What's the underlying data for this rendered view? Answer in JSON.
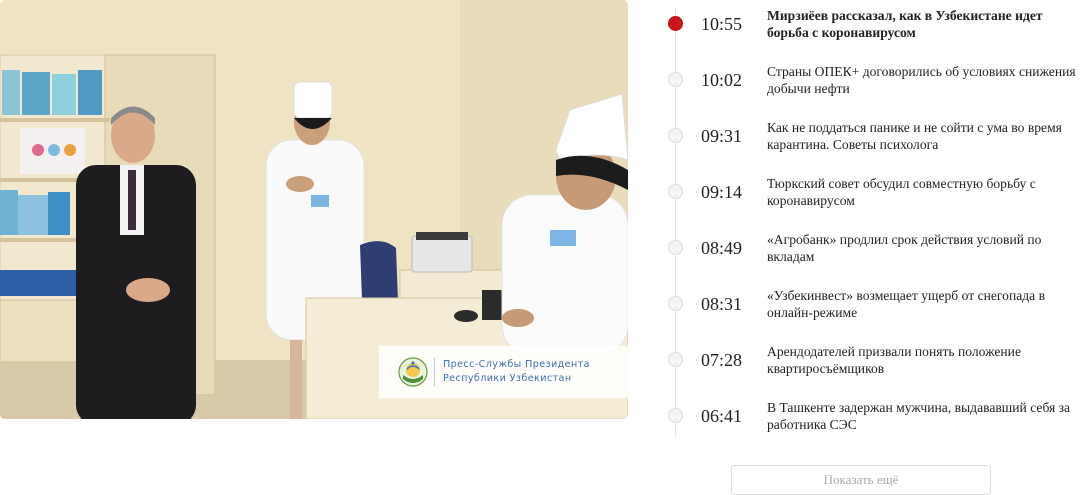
{
  "photo": {
    "credit_line1": "Пресс-Службы Президента",
    "credit_line2": "Республики Узбекистан",
    "emblem_icon": "uzbekistan-emblem-icon"
  },
  "news": [
    {
      "time": "10:55",
      "title": "Мирзиёев рассказал, как в Узбекистане идет борьба с коронавирусом",
      "active": true
    },
    {
      "time": "10:02",
      "title": "Страны ОПЕК+ договорились об условиях снижения добычи нефти",
      "active": false
    },
    {
      "time": "09:31",
      "title": "Как не поддаться панике и не сойти с ума во время карантина. Советы психолога",
      "active": false
    },
    {
      "time": "09:14",
      "title": "Тюркский совет обсудил совместную борьбу с коронавирусом",
      "active": false
    },
    {
      "time": "08:49",
      "title": "«Агробанк» продлил срок действия условий по вкладам",
      "active": false
    },
    {
      "time": "08:31",
      "title": "«Узбекинвест» возмещает ущерб от снегопада в онлайн-режиме",
      "active": false
    },
    {
      "time": "07:28",
      "title": "Арендодателей призвали понять положение квартиросъёмщиков",
      "active": false
    },
    {
      "time": "06:41",
      "title": "В Ташкенте задержан мужчина, выдававший себя за работника СЭС",
      "active": false
    }
  ],
  "more_button_label": "Показать ещё",
  "colors": {
    "accent": "#c9141b",
    "credit_text": "#3d6bb6"
  }
}
